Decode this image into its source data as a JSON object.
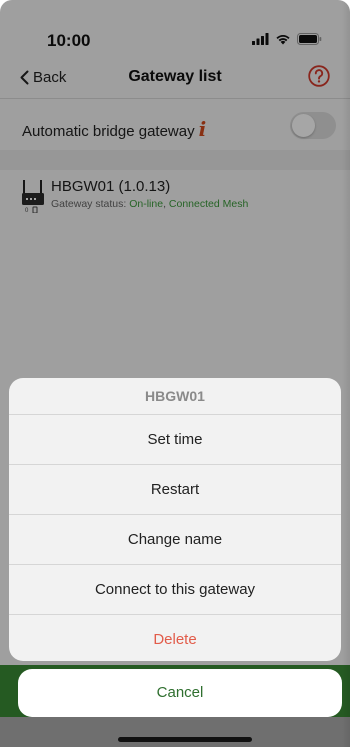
{
  "status_bar": {
    "time": "10:00"
  },
  "nav": {
    "back_label": "Back",
    "title": "Gateway list",
    "help_icon": "question-circle-icon"
  },
  "bridge": {
    "label": "Automatic bridge gateway",
    "info_glyph": "i",
    "toggle_on": false
  },
  "gateway": {
    "name": "HBGW01 (1.0.13)",
    "status_prefix": "Gateway status: ",
    "status_online": "On-line",
    "status_sep": ", ",
    "status_mesh": "Connected Mesh",
    "icon_badge": "0"
  },
  "action_sheet": {
    "title": "HBGW01",
    "items": [
      "Set time",
      "Restart",
      "Change name",
      "Connect to this gateway",
      "Delete"
    ],
    "cancel": "Cancel"
  },
  "colors": {
    "accent_green": "#3c9a3c",
    "destructive": "#e25c4a",
    "info_orange": "#d24a1e",
    "help_red": "#d33a2c"
  }
}
